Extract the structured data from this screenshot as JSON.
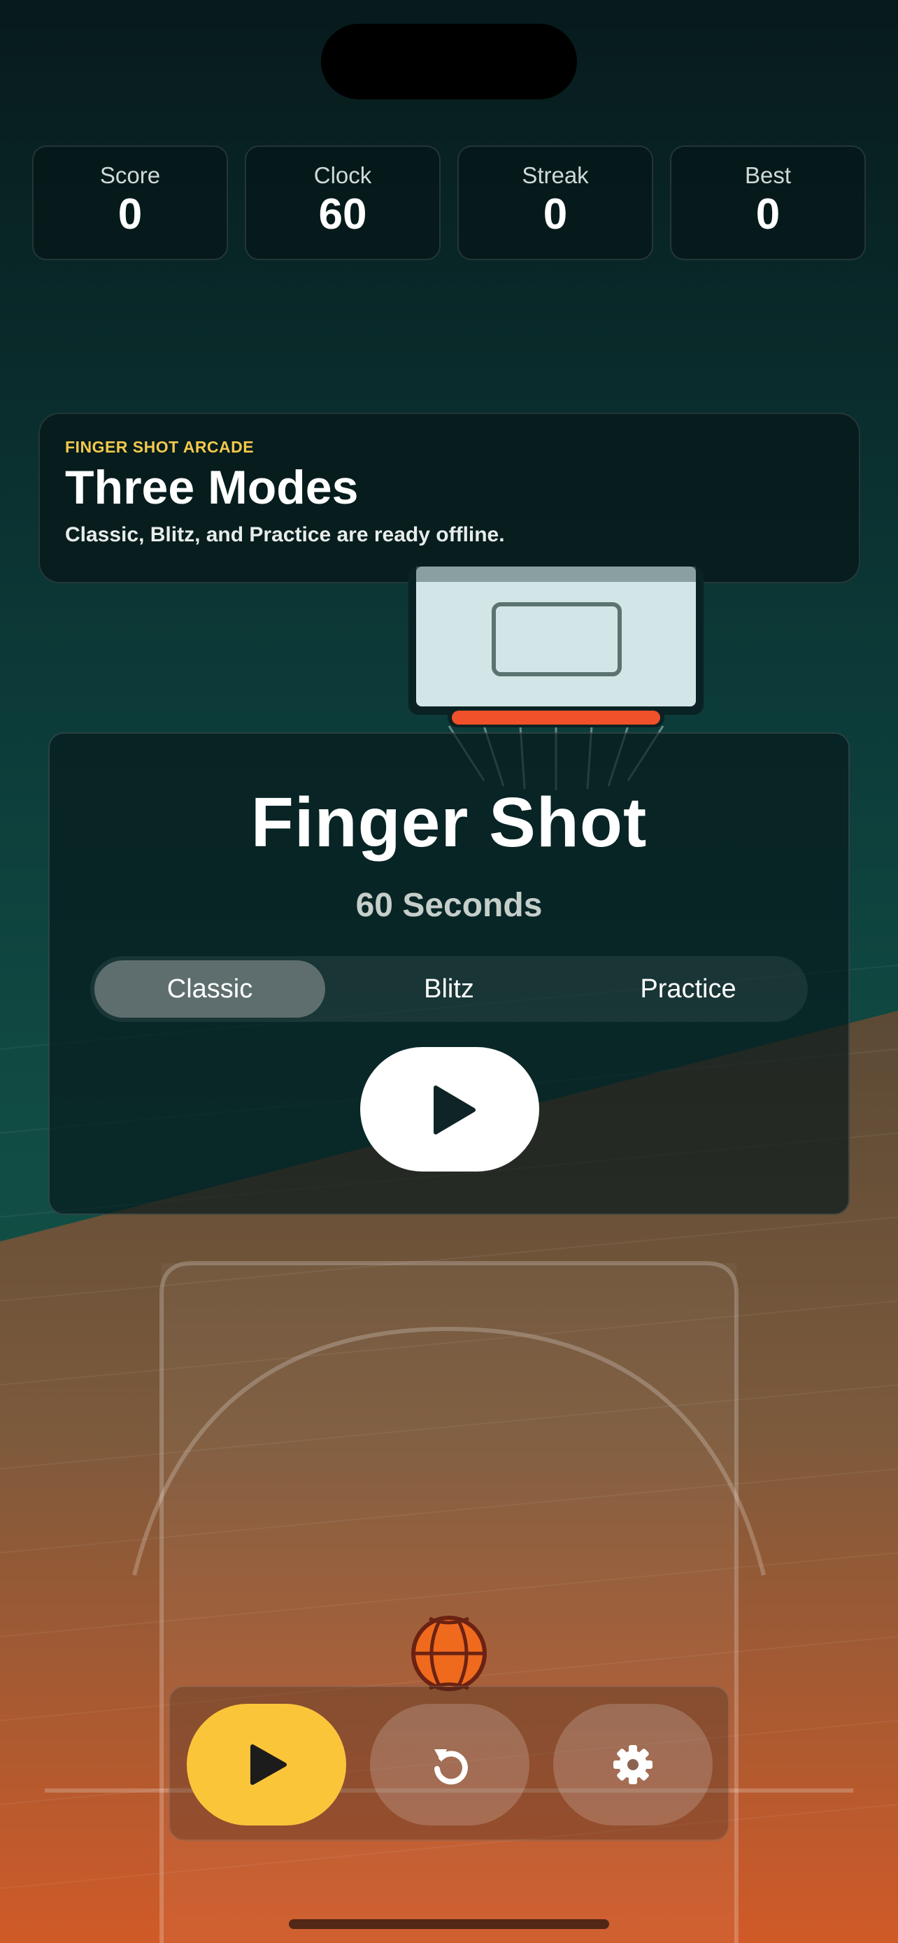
{
  "stats": [
    {
      "label": "Score",
      "value": "0"
    },
    {
      "label": "Clock",
      "value": "60"
    },
    {
      "label": "Streak",
      "value": "0"
    },
    {
      "label": "Best",
      "value": "0"
    }
  ],
  "banner": {
    "eyebrow": "FINGER SHOT ARCADE",
    "title": "Three Modes",
    "subtitle": "Classic, Blitz, and Practice are ready offline."
  },
  "panel": {
    "title": "Finger Shot",
    "subtitle": "60 Seconds",
    "modes": [
      "Classic",
      "Blitz",
      "Practice"
    ],
    "selected_mode": "Classic",
    "play_icon": "play-icon"
  },
  "controls": {
    "play_icon": "play-icon",
    "reset_icon": "restart-icon",
    "settings_icon": "gear-icon"
  },
  "colors": {
    "accent": "#fbc53a",
    "rim": "#f0502a",
    "ball": "#f06a1e",
    "court": "#c85a2c"
  }
}
